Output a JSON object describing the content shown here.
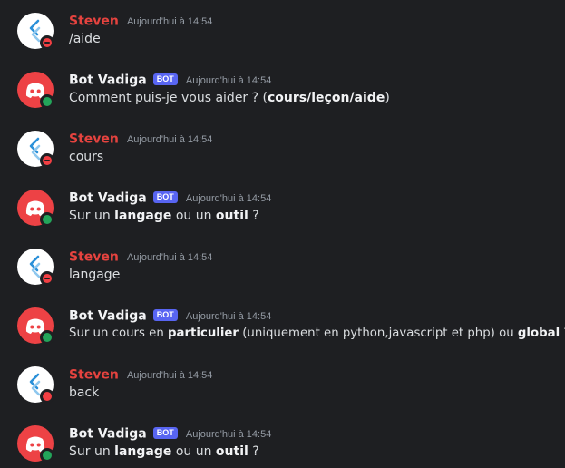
{
  "users": {
    "steven": {
      "name": "Steven",
      "status": "dnd",
      "name_color": "#e6433f",
      "avatar_icon": "stack-logo-icon"
    },
    "bot": {
      "name": "Bot Vadiga",
      "badge": "BOT",
      "status": "online",
      "avatar_color": "#ed4245",
      "avatar_icon": "discord-logo-icon"
    }
  },
  "messages": [
    {
      "author": "Steven",
      "time": "Aujourd'hui à 14:54",
      "text": "/aide"
    },
    {
      "author": "Bot Vadiga",
      "badge": "BOT",
      "time": "Aujourd'hui à 14:54",
      "parts": [
        "Comment puis-je vous aider ? (",
        "cours",
        "/",
        "leçon",
        "/",
        "aide",
        ")"
      ]
    },
    {
      "author": "Steven",
      "time": "Aujourd'hui à 14:54",
      "text": "cours"
    },
    {
      "author": "Bot Vadiga",
      "badge": "BOT",
      "time": "Aujourd'hui à 14:54",
      "parts": [
        "Sur un ",
        "langage",
        " ou un ",
        "outil",
        " ?"
      ]
    },
    {
      "author": "Steven",
      "time": "Aujourd'hui à 14:54",
      "text": "langage"
    },
    {
      "author": "Bot Vadiga",
      "badge": "BOT",
      "time": "Aujourd'hui à 14:54",
      "parts": [
        "Sur un cours en ",
        "particulier",
        " (uniquement en python,javascript et php) ou ",
        "global",
        " ?"
      ]
    },
    {
      "author": "Steven",
      "time": "Aujourd'hui à 14:54",
      "text": "back"
    },
    {
      "author": "Bot Vadiga",
      "badge": "BOT",
      "time": "Aujourd'hui à 14:54",
      "parts": [
        "Sur un ",
        "langage",
        " ou un ",
        "outil",
        " ?"
      ]
    }
  ],
  "colors": {
    "background": "#1e1f22",
    "text": "#dbdee1",
    "timestamp": "#949ba4",
    "bot_badge": "#5865f2",
    "status_dnd": "#f23f43",
    "status_online": "#23a55a"
  }
}
